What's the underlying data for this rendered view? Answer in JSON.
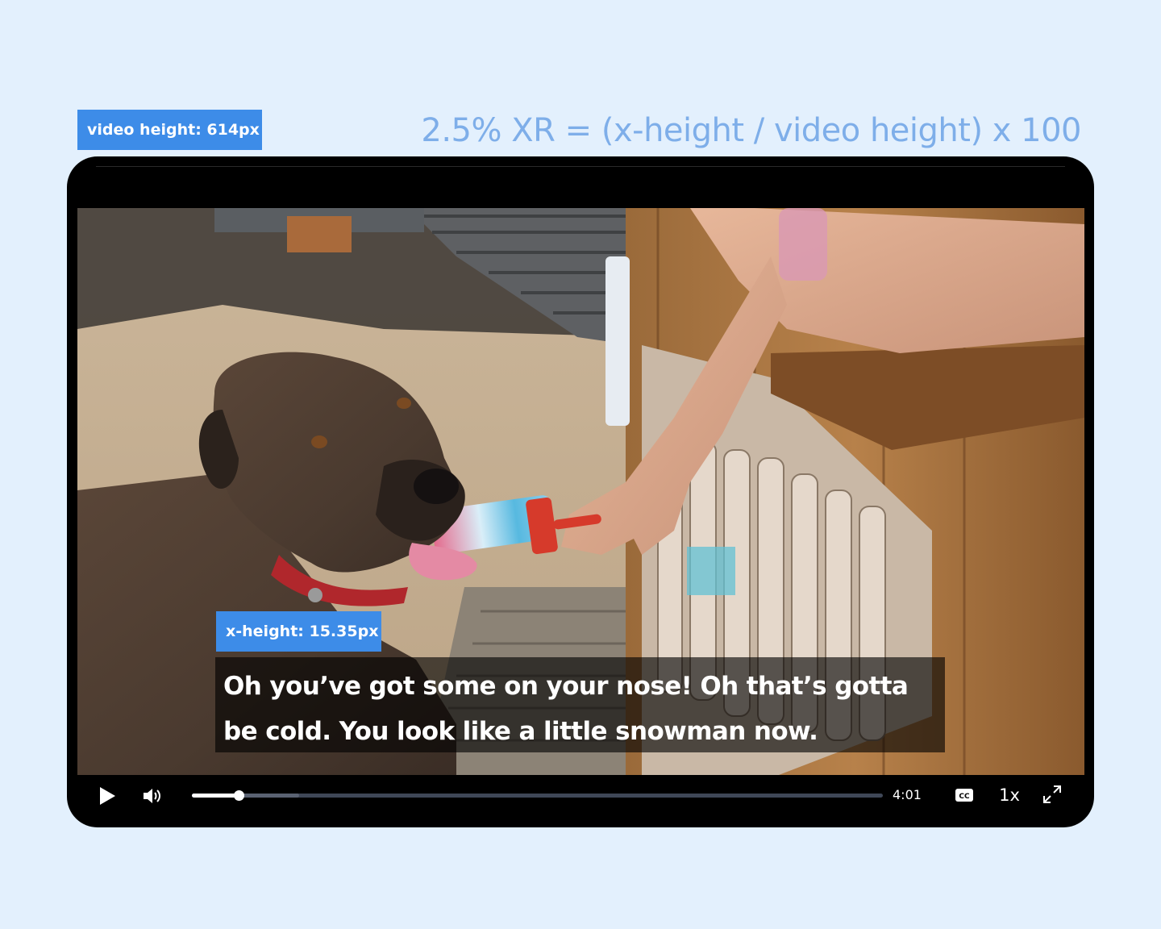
{
  "annotations": {
    "video_height_label": "video height: 614px",
    "formula": "2.5% XR = (x-height / video height) x 100",
    "x_height_label": "x-height: 15.35px"
  },
  "video": {
    "caption": "Oh you’ve got some on your nose! Oh that’s gotta be cold. You look like a little snowman now.",
    "scene_description_icon": "dog-licking-popsicle-image"
  },
  "controls": {
    "play_icon": "play-icon",
    "volume_icon": "volume-icon",
    "progress_played_fraction": 0.068,
    "progress_buffered_fraction": 0.155,
    "time": "4:01",
    "cc_label": "CC",
    "speed": "1x",
    "fullscreen_icon": "fullscreen-icon"
  },
  "colors": {
    "page_background": "#e3f0fd",
    "label_tag": "#3d8ce8",
    "formula_text": "#7eaee9",
    "player_background": "#000000"
  }
}
